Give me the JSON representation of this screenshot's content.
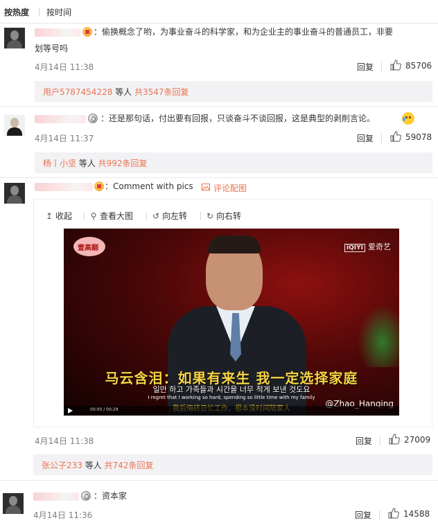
{
  "sort": {
    "hot": "按热度",
    "time": "按时间"
  },
  "comments": [
    {
      "text_line1": "：偷换概念了哟，为事业奋斗的科学家，和为企业主的事业奋斗的普通员工，非要",
      "text_line2": "划等号吗",
      "time": "4月14日 11:38",
      "reply_label": "回复",
      "likes": "85706",
      "reply_preview": {
        "user": "用户5787454228",
        "etc": " 等人 ",
        "count": "共3547条回复"
      }
    },
    {
      "text": "：还是那句话，付出要有回报，只谈奋斗不谈回报，这是典型的剥削言论。",
      "time": "4月14日 11:37",
      "reply_label": "回复",
      "likes": "59078",
      "reply_preview": {
        "user": "杨丨小坚",
        "etc": " 等人 ",
        "count": "共992条回复"
      }
    },
    {
      "text": "：Comment with pics",
      "pic_link": "评论配图",
      "toolbar": {
        "collapse": "收起",
        "view_large": "查看大图",
        "rotate_left": "向左转",
        "rotate_right": "向右转"
      },
      "video": {
        "logo": "壹高翻",
        "channel": "爱奇艺",
        "subtitle_cn": "马云含泪：如果有来生 我一定选择家庭",
        "subtitle_kr": "일만 하고 가족들과 시간을 너무 적게 보낸 것도요",
        "subtitle_en": "I regret that I working so hard, spending so little time with my family",
        "subtitle_cn2": "我后悔终日忙工作，根本没时间陪家人",
        "watermark": "@Zhao_Hanqing",
        "time": "00:00 / 00:29"
      },
      "time": "4月14日 11:38",
      "reply_label": "回复",
      "likes": "27009",
      "reply_preview": {
        "user": "张公子233",
        "etc": " 等人 ",
        "count": "共742条回复"
      }
    },
    {
      "text": "：资本家",
      "time": "4月14日 11:36",
      "reply_label": "回复",
      "likes": "14588"
    }
  ],
  "colors": {
    "link": "#eb7350",
    "reply_bg": "#f2f2f5",
    "time": "#808080"
  }
}
